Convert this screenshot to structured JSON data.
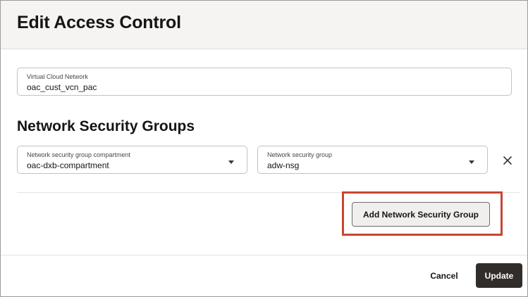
{
  "dialog": {
    "title": "Edit Access Control"
  },
  "vcn_field": {
    "label": "Virtual Cloud Network",
    "value": "oac_cust_vcn_pac"
  },
  "nsg_section": {
    "title": "Network Security Groups",
    "compartment_select": {
      "label": "Network security group compartment",
      "value": "oac-dxb-compartment"
    },
    "group_select": {
      "label": "Network security group",
      "value": "adw-nsg"
    },
    "remove_icon": "close-icon",
    "add_button_label": "Add Network Security Group"
  },
  "footer": {
    "cancel_label": "Cancel",
    "update_label": "Update"
  },
  "colors": {
    "highlight": "#c74634",
    "primary_button": "#312d2a",
    "header_bg": "#f5f4f2"
  }
}
